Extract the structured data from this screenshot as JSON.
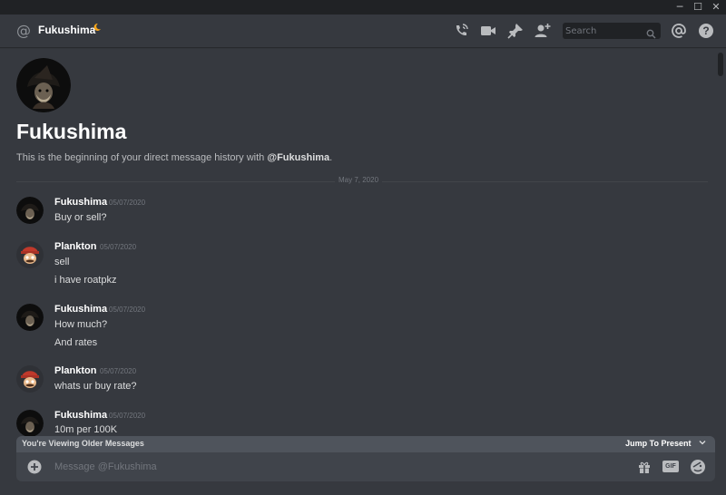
{
  "window": {
    "minimize": "─",
    "maximize": "☐",
    "close": "✕"
  },
  "header": {
    "channel_icon": "at-icon",
    "name": "Fukushima",
    "status_icon": "moon-icon",
    "search_placeholder": "Search",
    "icons": [
      "call-icon",
      "video-icon",
      "pin-icon",
      "add-friend-icon",
      "mention-icon",
      "help-icon"
    ]
  },
  "intro": {
    "name": "Fukushima",
    "desc_prefix": "This is the beginning of your direct message history with ",
    "desc_handle": "@Fukushima",
    "desc_suffix": "."
  },
  "divider_date": "May 7, 2020",
  "messages": [
    {
      "author": "Fukushima",
      "timestamp": "05/07/2020",
      "lines": [
        "Buy or sell?"
      ]
    },
    {
      "author": "Plankton",
      "timestamp": "05/07/2020",
      "lines": [
        "sell",
        "i have roatpkz"
      ]
    },
    {
      "author": "Fukushima",
      "timestamp": "05/07/2020",
      "lines": [
        "How much?",
        "And rates"
      ]
    },
    {
      "author": "Plankton",
      "timestamp": "05/07/2020",
      "lines": [
        "whats ur buy rate?"
      ]
    },
    {
      "author": "Fukushima",
      "timestamp": "05/07/2020",
      "lines": [
        "10m per 100K"
      ]
    }
  ],
  "older_bar": {
    "text": "You're Viewing Older Messages",
    "jump": "Jump To Present"
  },
  "composer": {
    "placeholder": "Message @Fukushima",
    "gif_label": "GIF"
  },
  "colors": {
    "background": "#36393f",
    "sidebar_dark": "#202225",
    "composer": "#40444b",
    "status_idle": "#faa61a"
  }
}
